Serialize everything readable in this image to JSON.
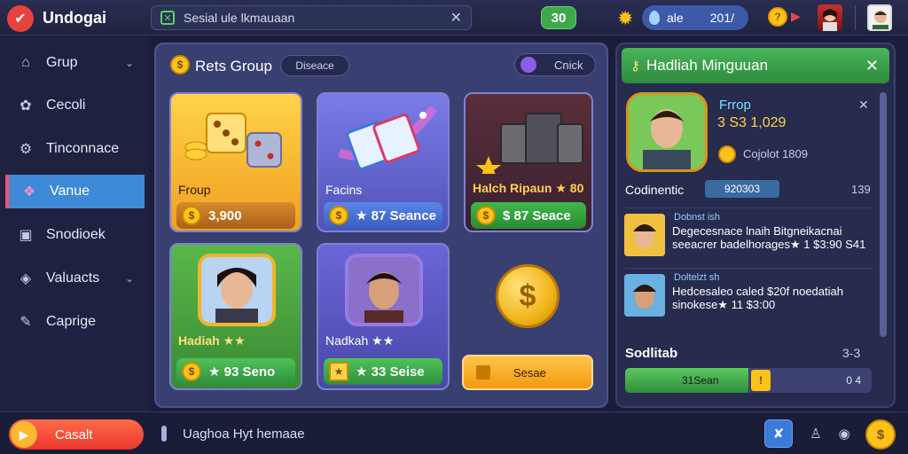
{
  "app": {
    "name": "Undogai"
  },
  "search": {
    "value": "Sesial ule lkmauaan"
  },
  "header": {
    "score": "30",
    "pill_label": "ale",
    "pill_value": "201/"
  },
  "sidebar": {
    "items": [
      {
        "label": "Grup",
        "icon": "home-icon"
      },
      {
        "label": "Cecoli",
        "icon": "leaf-icon"
      },
      {
        "label": "Tinconnace",
        "icon": "gear-icon"
      },
      {
        "label": "Vanue",
        "icon": "gift-icon"
      },
      {
        "label": "Snodioek",
        "icon": "calendar-icon"
      },
      {
        "label": "Valuacts",
        "icon": "tag-icon"
      },
      {
        "label": "Caprige",
        "icon": "pencil-icon"
      }
    ]
  },
  "main": {
    "title": "Rets Group",
    "tag": "Diseace",
    "toggle_label": "Cnick",
    "cards": [
      {
        "label": "Froup",
        "button": "3,900"
      },
      {
        "label": "Facins",
        "button": "★ 87 Seance"
      },
      {
        "label": "Halch Ripaun ★ 80",
        "button": "$ 87 Seace"
      },
      {
        "label": "Hadiah ★★",
        "button": "★ 93 Seno"
      },
      {
        "label": "Nadkah ★★",
        "button": "★ 33 Seise"
      }
    ],
    "cta_label": "Sesae"
  },
  "panel": {
    "title": "Hadliah Minguuan",
    "profile_name": "Frrop",
    "profile_value": "3 S3 1,029",
    "profile_sub": "Cojolot 1809",
    "section_label": "Codinentic",
    "section_value": "920303",
    "section_count": "139",
    "list": [
      {
        "title": "Dobnst ish",
        "text": "Degecesnace lnaih Bitgneikacnai seeacrer badelhorages★ 1 $3:90 S41"
      },
      {
        "title": "Doltelzt sh",
        "text": "Hedcesaleo caled $20f noedatiah sinokese★ 11 $3:00"
      }
    ],
    "progress_title": "Sodlitab",
    "progress_count": "3-3",
    "progress_label": "31Sean",
    "progress_end": "0 4",
    "progress_fraction": 0.5
  },
  "footer": {
    "play_label": "Casalt",
    "message": "Uaghoa Hyt hemaae"
  },
  "colors": {
    "accent_green": "#48b55a",
    "active_blue": "#3e8ad8",
    "coin_gold": "#ffc21a"
  }
}
